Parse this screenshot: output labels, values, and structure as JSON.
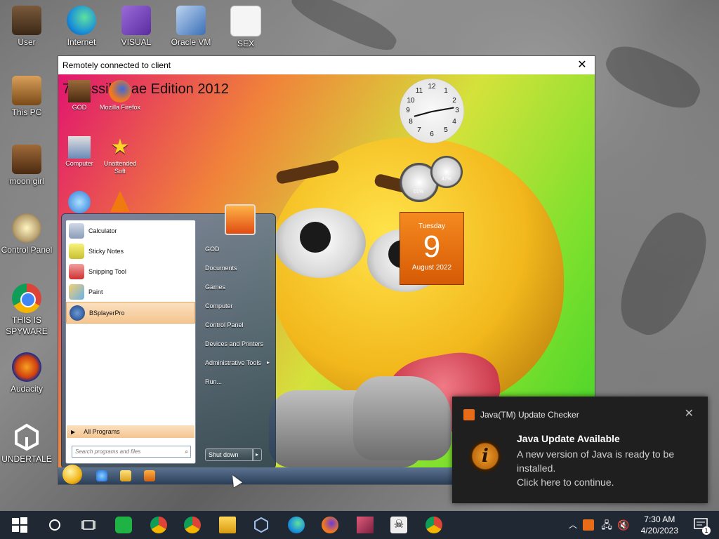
{
  "desktop": {
    "icons": [
      {
        "label": "User",
        "icon": "user-folder-icon"
      },
      {
        "label": "Internet",
        "icon": "edge-icon"
      },
      {
        "label": "VISUAL",
        "icon": "visual-studio-icon"
      },
      {
        "label": "Oracle VM",
        "icon": "virtualbox-icon"
      },
      {
        "label": "SEX",
        "icon": "hxd-icon"
      },
      {
        "label": "This PC",
        "icon": "computer-icon"
      },
      {
        "label": "moon girl",
        "icon": "game-icon"
      },
      {
        "label": "Control Panel",
        "icon": "control-panel-icon"
      },
      {
        "label": "THIS IS SPYWARE",
        "icon": "chrome-icon"
      },
      {
        "label": "Audacity",
        "icon": "audacity-icon"
      },
      {
        "label": "UNDERTALE",
        "icon": "unity-icon"
      }
    ]
  },
  "remote_window": {
    "title": "Remotely connected to client",
    "screen_title": "7 Possible ae Edition 2012",
    "inner_icons": [
      {
        "label": "GOD"
      },
      {
        "label": "Mozilla Firefox"
      },
      {
        "label": "Computer"
      },
      {
        "label": "Unattended Soft"
      }
    ],
    "clock_numbers": [
      "12",
      "1",
      "2",
      "3",
      "4",
      "5",
      "6",
      "7",
      "8",
      "9",
      "10",
      "11"
    ],
    "gauges": [
      {
        "label": "01%"
      },
      {
        "label": "47%"
      }
    ],
    "calendar": {
      "day": "Tuesday",
      "date": "9",
      "month": "August 2022"
    },
    "start_menu": {
      "programs": [
        "Calculator",
        "Sticky Notes",
        "Snipping Tool",
        "Paint",
        "BSplayerPro"
      ],
      "all_programs": "All Programs",
      "search_placeholder": "Search programs and files",
      "right_items": [
        "GOD",
        "Documents",
        "Games",
        "Computer",
        "Control Panel",
        "Devices and Printers",
        "Administrative Tools",
        "Run..."
      ],
      "shutdown": "Shut down"
    }
  },
  "notification": {
    "app": "Java(TM) Update Checker",
    "title": "Java Update Available",
    "body": "A new version of Java is ready to be installed.",
    "action": "Click here to continue."
  },
  "taskbar": {
    "time": "7:30 AM",
    "date": "4/20/2023",
    "notification_count": "1"
  },
  "colors": {
    "taskbar": "#202833",
    "toast": "#1f1f1f",
    "calendar": "#e8700f"
  }
}
